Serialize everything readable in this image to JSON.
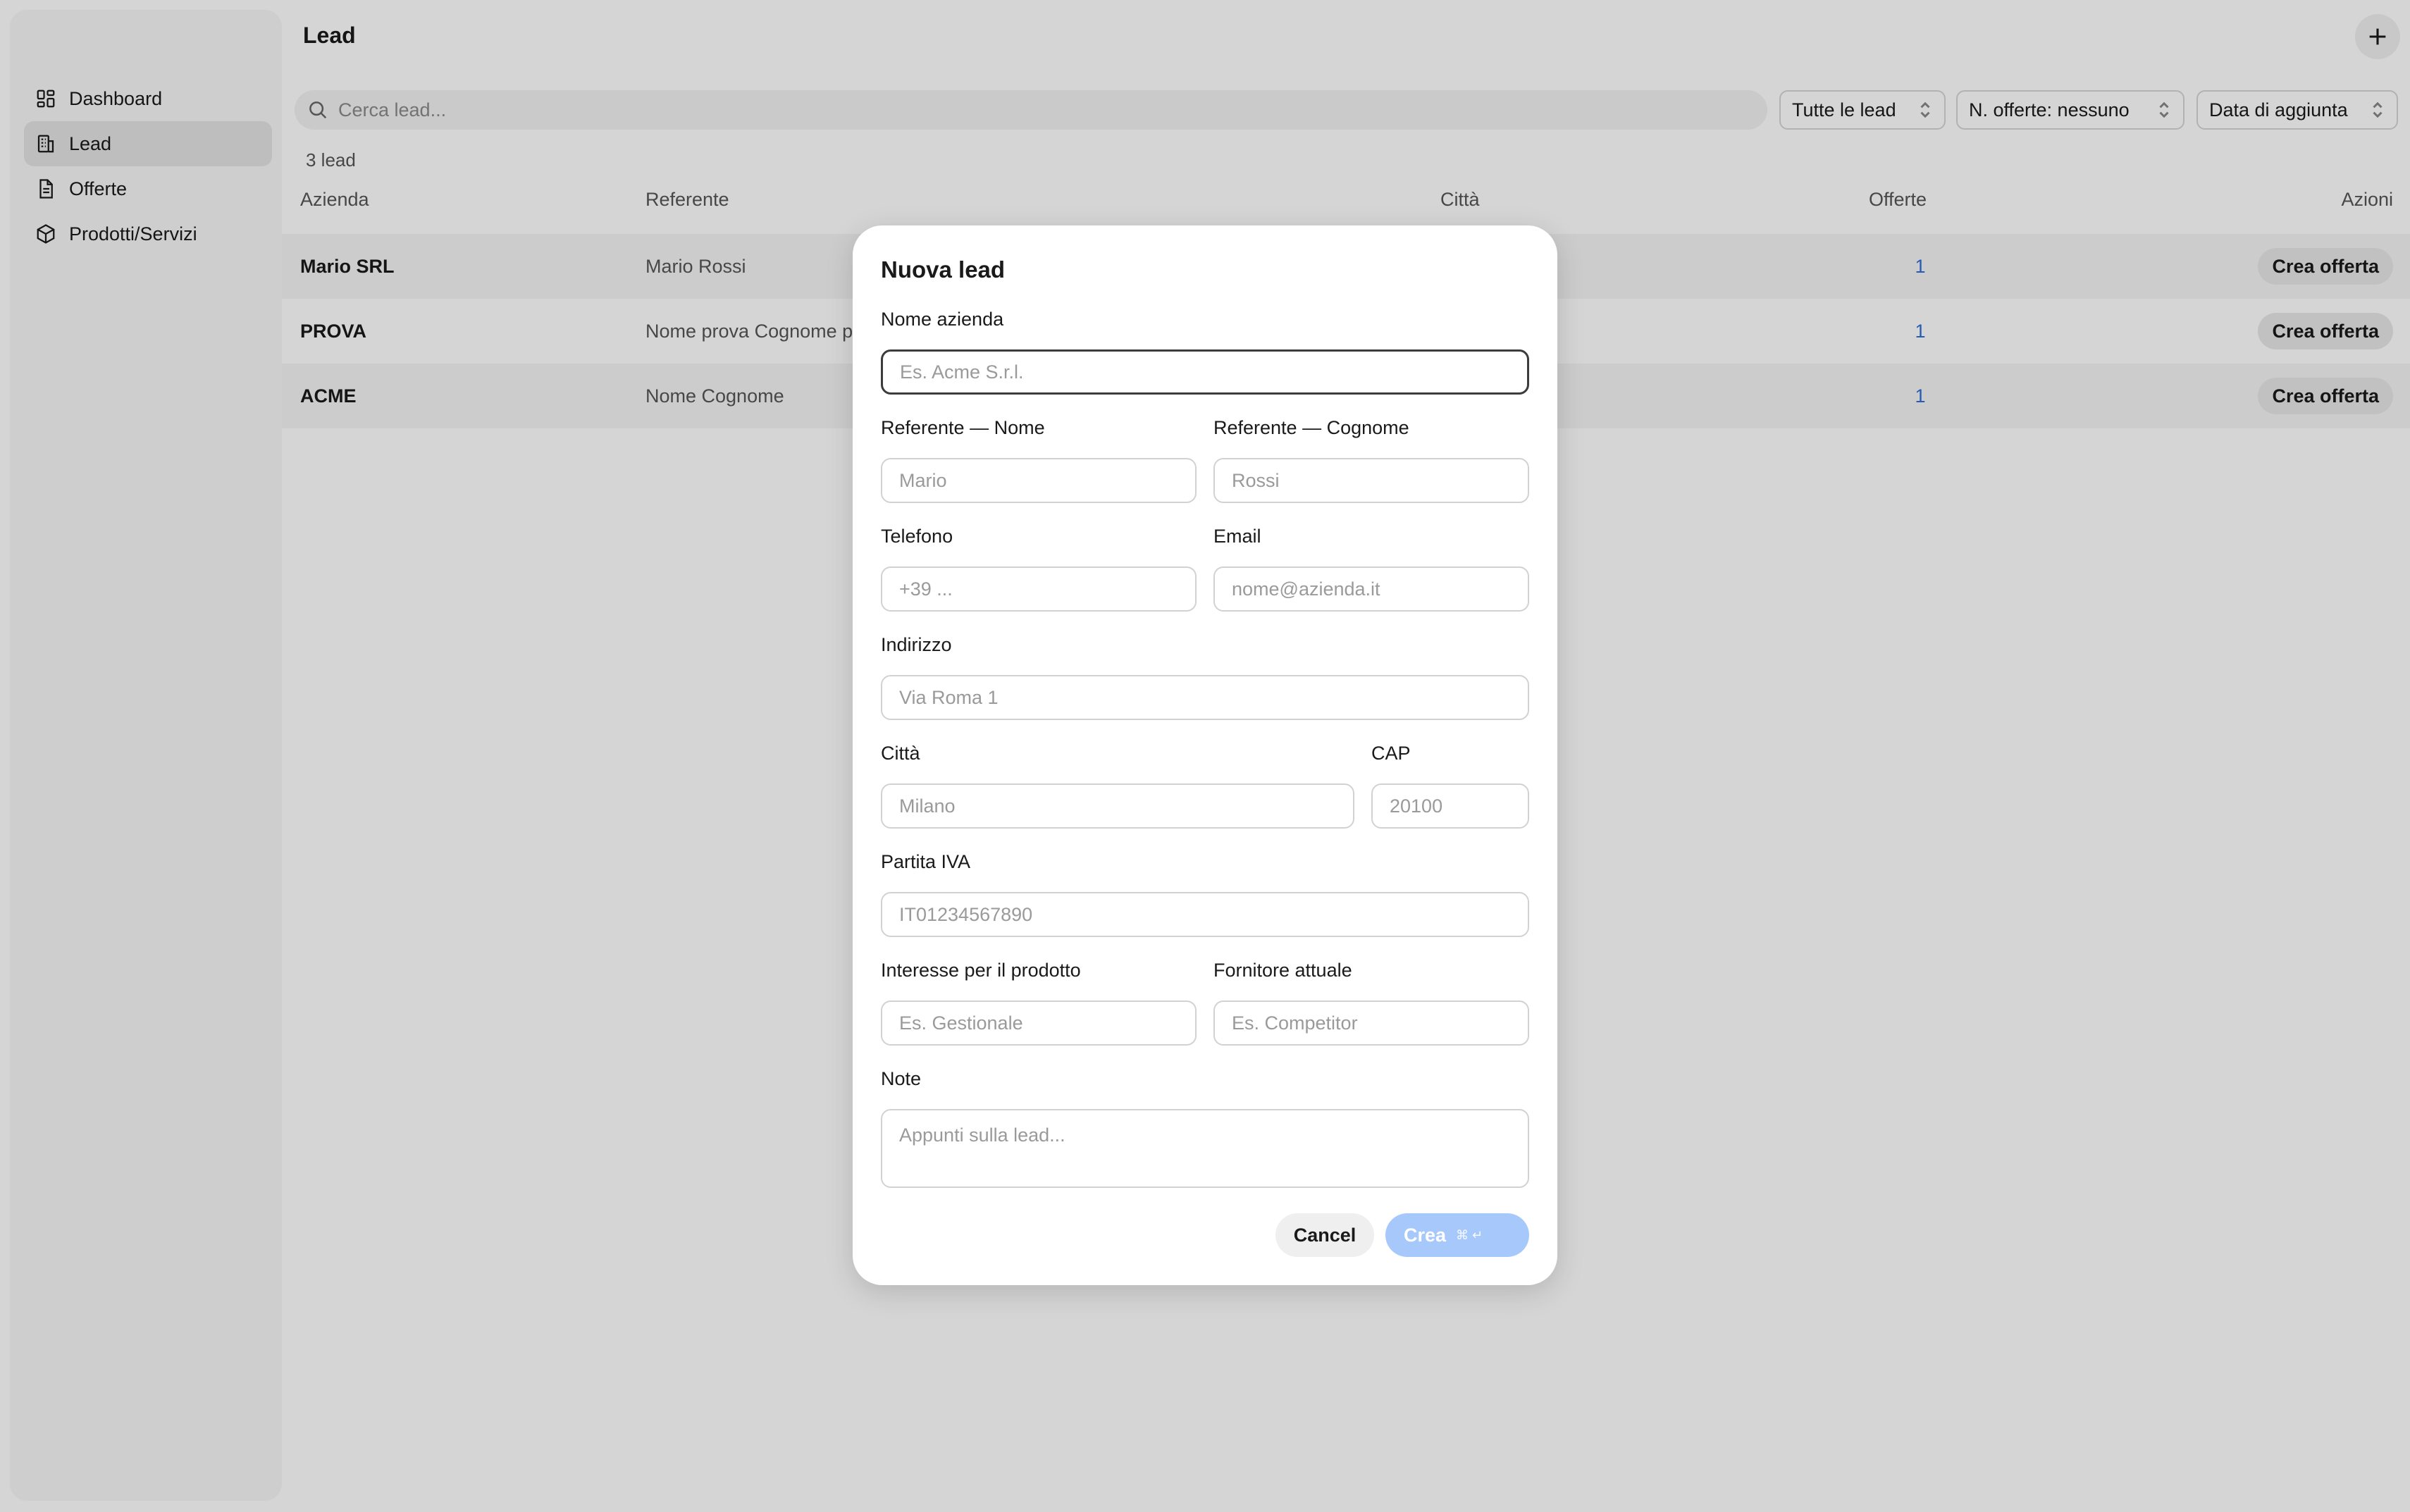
{
  "sidebar": {
    "items": [
      {
        "label": "Dashboard",
        "icon": "dashboard-icon",
        "active": false
      },
      {
        "label": "Lead",
        "icon": "building-icon",
        "active": true
      },
      {
        "label": "Offerte",
        "icon": "document-icon",
        "active": false
      },
      {
        "label": "Prodotti/Servizi",
        "icon": "box-icon",
        "active": false
      }
    ]
  },
  "header": {
    "title": "Lead"
  },
  "search": {
    "placeholder": "Cerca lead..."
  },
  "filters": {
    "status": "Tutte le lead",
    "offers": "N. offerte: nessuno",
    "sort": "Data di aggiunta"
  },
  "count": "3 lead",
  "table": {
    "columns": [
      "Azienda",
      "Referente",
      "Città",
      "Offerte",
      "Azioni"
    ],
    "rows": [
      {
        "azienda": "Mario SRL",
        "referente": "Mario Rossi",
        "offerte": "1",
        "azione": "Crea offerta"
      },
      {
        "azienda": "PROVA",
        "referente": "Nome prova Cognome p",
        "offerte": "1",
        "azione": "Crea offerta"
      },
      {
        "azienda": "ACME",
        "referente": "Nome Cognome",
        "offerte": "1",
        "azione": "Crea offerta"
      }
    ]
  },
  "modal": {
    "title": "Nuova lead",
    "fields": {
      "azienda": {
        "label": "Nome azienda",
        "placeholder": "Es. Acme S.r.l."
      },
      "nome": {
        "label": "Referente — Nome",
        "placeholder": "Mario"
      },
      "cognome": {
        "label": "Referente — Cognome",
        "placeholder": "Rossi"
      },
      "telefono": {
        "label": "Telefono",
        "placeholder": "+39 ..."
      },
      "email": {
        "label": "Email",
        "placeholder": "nome@azienda.it"
      },
      "indirizzo": {
        "label": "Indirizzo",
        "placeholder": "Via Roma 1"
      },
      "citta": {
        "label": "Città",
        "placeholder": "Milano"
      },
      "cap": {
        "label": "CAP",
        "placeholder": "20100"
      },
      "piva": {
        "label": "Partita IVA",
        "placeholder": "IT01234567890"
      },
      "interesse": {
        "label": "Interesse per il prodotto",
        "placeholder": "Es. Gestionale"
      },
      "fornitore": {
        "label": "Fornitore attuale",
        "placeholder": "Es. Competitor"
      },
      "note": {
        "label": "Note",
        "placeholder": "Appunti sulla lead..."
      }
    },
    "cancel_label": "Cancel",
    "create_label": "Crea",
    "create_shortcut": "⌘ ↵"
  },
  "colors": {
    "accent": "#a7c8fb",
    "link": "#2f6fd6"
  }
}
